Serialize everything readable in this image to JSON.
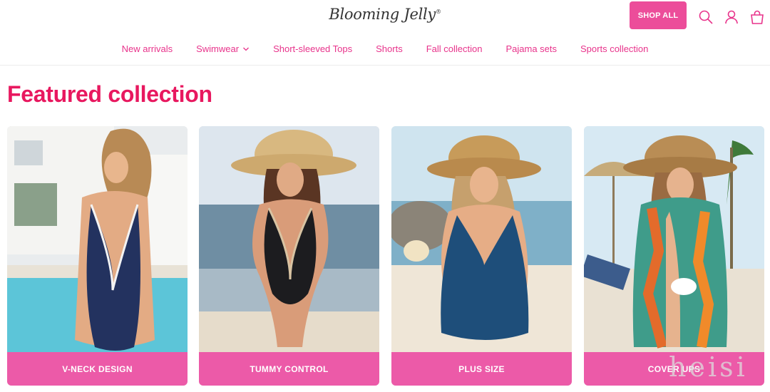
{
  "header": {
    "logo_text": "Blooming Jelly",
    "logo_mark": "®",
    "shop_all_label": "SHOP ALL",
    "icons": [
      "search-icon",
      "account-icon",
      "cart-icon"
    ]
  },
  "nav": {
    "items": [
      {
        "label": "New arrivals"
      },
      {
        "label": "Swimwear"
      },
      {
        "label": "Short-sleeved Tops"
      },
      {
        "label": "Shorts"
      },
      {
        "label": "Fall collection"
      },
      {
        "label": "Pajama sets"
      },
      {
        "label": "Sports collection"
      }
    ]
  },
  "section": {
    "title": "Featured collection",
    "cards": [
      {
        "label": "V-NECK DESIGN"
      },
      {
        "label": "TUMMY CONTROL"
      },
      {
        "label": "PLUS SIZE"
      },
      {
        "label": "COVER UPS"
      }
    ]
  },
  "watermark": "heisi",
  "colors": {
    "accent": "#ec4d9a",
    "nav_text": "#e8338b",
    "title": "#e8185f",
    "card_label_bg": "#ec5aa8"
  }
}
